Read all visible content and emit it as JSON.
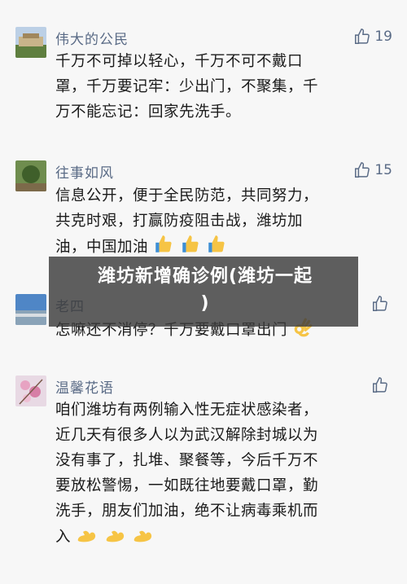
{
  "comments": [
    {
      "nickname": "伟大的公民",
      "likes": "19",
      "text_lines": [
        "千万不可掉以轻心，千万不可不戴口",
        "罩，千万要记牢：少出门，不聚集，千",
        "万不能忘记：回家先洗手。"
      ]
    },
    {
      "nickname": "往事如风",
      "likes": "15",
      "text_lines": [
        "信息公开，便于全民防范，共同努力，",
        "共克时艰，打赢防疫阻击战，潍坊加",
        "油，中国加油"
      ]
    },
    {
      "nickname": "老四",
      "likes": "",
      "text_lines": [
        "怎嘛还不消停？千万要戴口罩出门"
      ]
    },
    {
      "nickname": "温馨花语",
      "likes": "",
      "text_lines": [
        "咱们潍坊有两例输入性无症状感染者，",
        "近几天有很多人以为武汉解除封城以为",
        "没有事了，扎堆、聚餐等，今后千万不",
        "要放松警惕，一如既往地要戴口罩，勤",
        "洗手，朋友们加油，绝不让病毒乘机而",
        "入"
      ]
    }
  ],
  "overlay": {
    "line1": "潍坊新增确诊例(潍坊一起",
    "line2": ")"
  },
  "icons": {
    "like": "thumbs-up-outline-icon",
    "thumbs_emoji": "thumbs-up-emoji",
    "ok_emoji": "ok-hand-emoji",
    "muscle_emoji": "flexed-biceps-emoji"
  },
  "colors": {
    "nickname": "#5a6b86",
    "text": "#1b1b1b",
    "background": "#f7f7f7",
    "emoji_yellow": "#f6c445"
  }
}
